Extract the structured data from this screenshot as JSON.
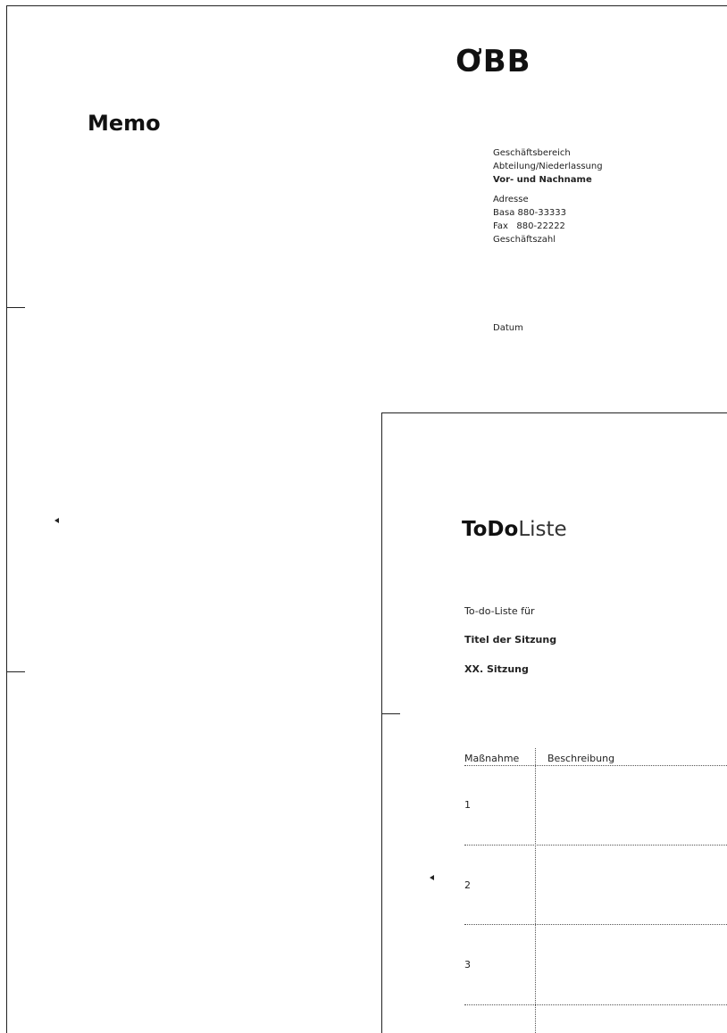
{
  "logo": {
    "text": "ƠBB"
  },
  "memo": {
    "title": "Memo",
    "sender_lines": {
      "division": "Geschäftsbereich",
      "department": "Abteilung/Niederlassung",
      "name": "Vor- und Nachname",
      "address": "Adresse",
      "phone": "Basa 880-33333",
      "fax": "Fax   880-22222",
      "file_number": "Geschäftszahl"
    },
    "date_label": "Datum"
  },
  "todo": {
    "title_strong": "ToDo",
    "title_light": "Liste",
    "for_label": "To-do-Liste für",
    "meeting_title": "Titel der Sitzung",
    "meeting_number": "XX. Sitzung",
    "table": {
      "headers": [
        "Maßnahme",
        "Beschreibung"
      ],
      "rows": [
        "1",
        "2",
        "3"
      ]
    }
  }
}
